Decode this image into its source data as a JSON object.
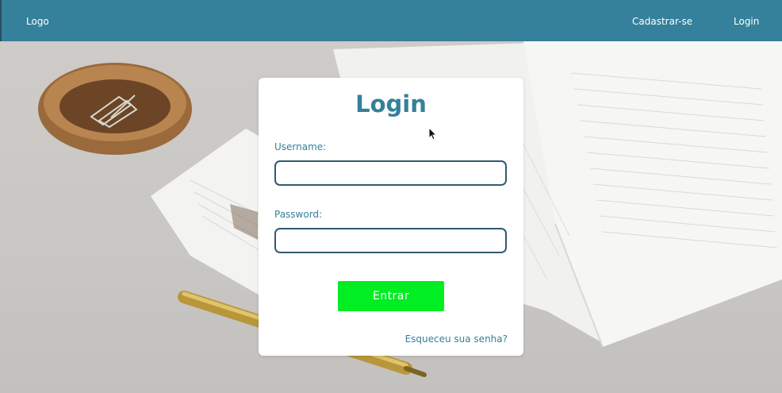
{
  "navbar": {
    "logo": "Logo",
    "signup_link": "Cadastrar-se",
    "login_link": "Login"
  },
  "login": {
    "title": "Login",
    "username_label": "Username:",
    "username_value": "",
    "password_label": "Password:",
    "password_value": "",
    "submit_label": "Entrar",
    "forgot_link": "Esqueceu sua senha?"
  },
  "colors": {
    "navbar": "#35809a",
    "accent": "#35809a",
    "button": "#00ee22",
    "input_border": "#2f5a70"
  }
}
